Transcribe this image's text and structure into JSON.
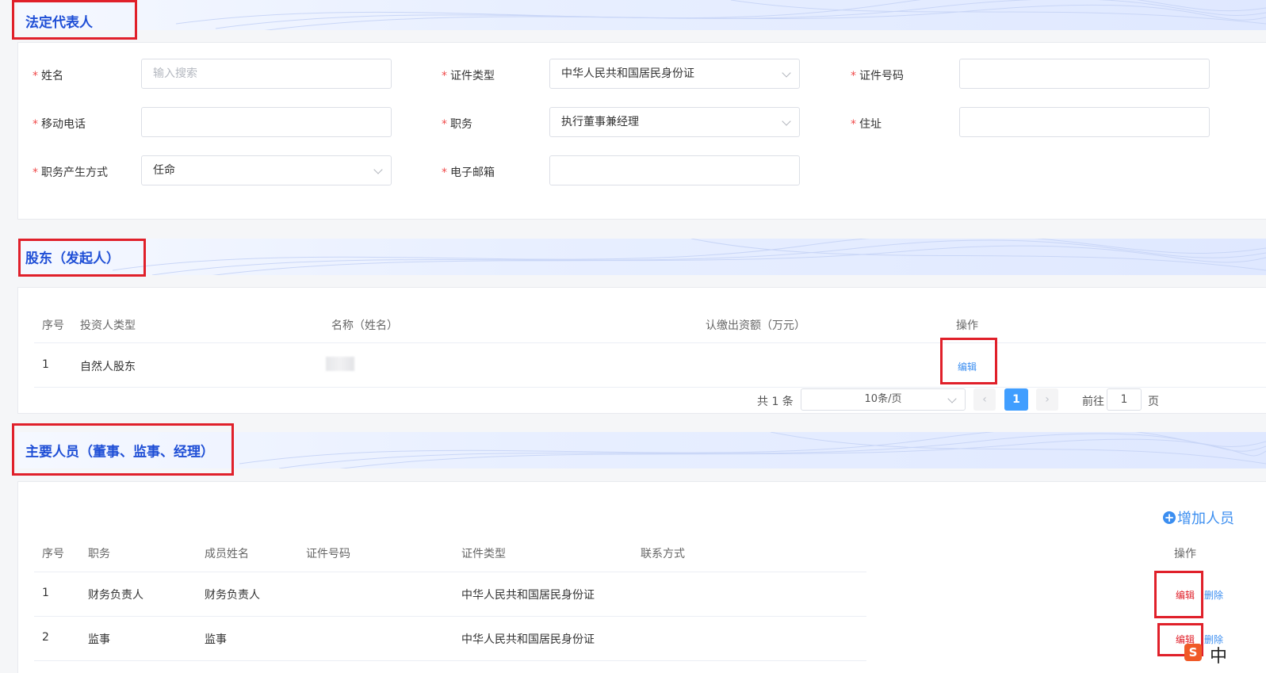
{
  "sections": {
    "legal_rep_title": "法定代表人",
    "shareholders_title": "股东（发起人）",
    "key_personnel_title": "主要人员（董事、监事、经理）"
  },
  "legal_rep": {
    "name_label": "姓名",
    "name_placeholder": "输入搜索",
    "id_type_label": "证件类型",
    "id_type_value": "中华人民共和国居民身份证",
    "id_number_label": "证件号码",
    "mobile_label": "移动电话",
    "position_label": "职务",
    "position_value": "执行董事兼经理",
    "address_label": "住址",
    "appoint_label": "职务产生方式",
    "appoint_value": "任命",
    "email_label": "电子邮箱"
  },
  "shareholders": {
    "columns": [
      "序号",
      "投资人类型",
      "名称（姓名）",
      "认缴出资额（万元）",
      "操作"
    ],
    "rows": [
      {
        "index": "1",
        "type": "自然人股东",
        "action": "编辑"
      }
    ],
    "pagination": {
      "total": "共 1 条",
      "page_size": "10条/页",
      "prev": "‹",
      "current": "1",
      "next": "›",
      "goto_prefix": "前往",
      "goto_value": "1",
      "goto_suffix": "页"
    }
  },
  "key_personnel": {
    "add_button": "增加人员",
    "columns": [
      "序号",
      "职务",
      "成员姓名",
      "证件号码",
      "证件类型",
      "联系方式",
      "操作"
    ],
    "rows": [
      {
        "index": "1",
        "position": "财务负责人",
        "name": "财务负责人",
        "id_type": "中华人民共和国居民身份证",
        "edit": "编辑",
        "delete": "删除"
      },
      {
        "index": "2",
        "position": "监事",
        "name": "监事",
        "id_type": "中华人民共和国居民身份证",
        "edit": "编辑",
        "delete": "删除"
      }
    ]
  },
  "ime": {
    "label": "中"
  },
  "colors": {
    "title_blue": "#1f4fd6",
    "link_blue": "#3b8ef0",
    "required_red": "#f04b4b",
    "highlight_red": "#e0202a",
    "pager_active": "#409eff"
  }
}
